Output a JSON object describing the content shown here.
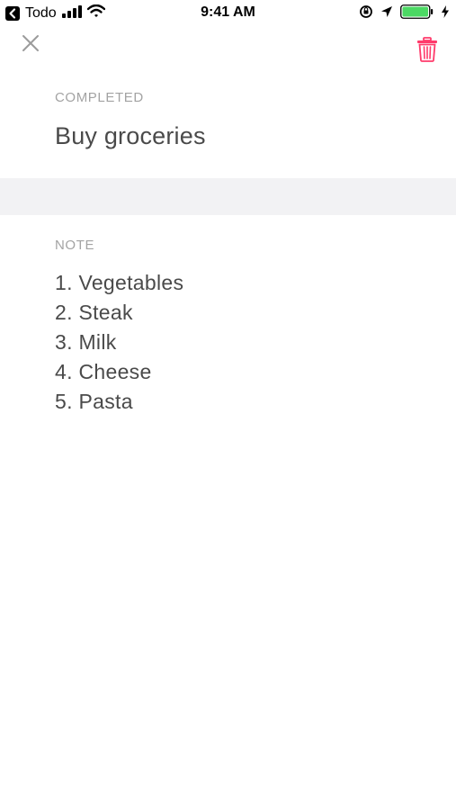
{
  "status_bar": {
    "back_app": "Todo",
    "time": "9:41 AM",
    "battery_color": "#4cd964"
  },
  "icons": {
    "close": "close-icon",
    "trash": "trash-icon"
  },
  "colors": {
    "trash": "#ff3b6b",
    "label": "#a3a3a3",
    "text": "#4a4a4a",
    "band": "#f2f2f4"
  },
  "task": {
    "status_label": "COMPLETED",
    "title": "Buy groceries"
  },
  "note": {
    "label": "NOTE",
    "items": [
      "1. Vegetables",
      "2. Steak",
      "3. Milk",
      "4. Cheese",
      "5. Pasta"
    ]
  }
}
